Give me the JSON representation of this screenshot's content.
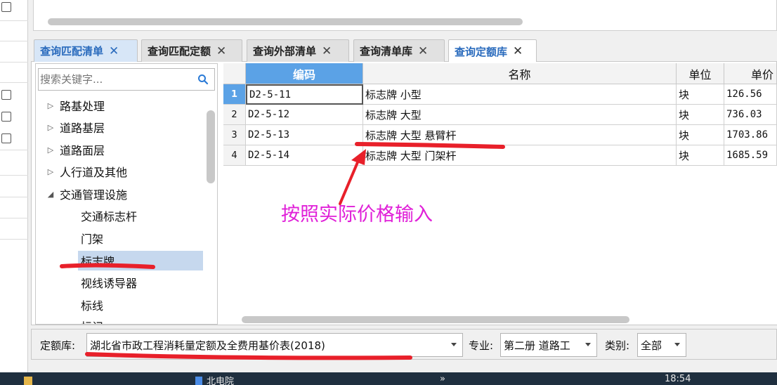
{
  "tabs": [
    {
      "label": "查询匹配清单",
      "state": "blue"
    },
    {
      "label": "查询匹配定额",
      "state": "normal"
    },
    {
      "label": "查询外部清单",
      "state": "normal"
    },
    {
      "label": "查询清单库",
      "state": "normal"
    },
    {
      "label": "查询定额库",
      "state": "active"
    }
  ],
  "tab_close_glyph": "✕",
  "search": {
    "placeholder": "搜索关键字..."
  },
  "tree": {
    "items": [
      {
        "label": "路基处理",
        "expanded": false
      },
      {
        "label": "道路基层",
        "expanded": false
      },
      {
        "label": "道路面层",
        "expanded": false
      },
      {
        "label": "人行道及其他",
        "expanded": false
      },
      {
        "label": "交通管理设施",
        "expanded": true
      }
    ],
    "children": [
      {
        "label": "交通标志杆",
        "selected": false
      },
      {
        "label": "门架",
        "selected": false
      },
      {
        "label": "标志牌",
        "selected": true
      },
      {
        "label": "视线诱导器",
        "selected": false
      },
      {
        "label": "标线",
        "selected": false
      },
      {
        "label": "标记",
        "selected": false
      }
    ]
  },
  "grid": {
    "headers": {
      "code": "编码",
      "name": "名称",
      "unit": "单位",
      "price": "单价"
    },
    "rows": [
      {
        "num": "1",
        "code": "D2-5-11",
        "name": "标志牌 小型",
        "unit": "块",
        "price": "126.56"
      },
      {
        "num": "2",
        "code": "D2-5-12",
        "name": "标志牌 大型",
        "unit": "块",
        "price": "736.03"
      },
      {
        "num": "3",
        "code": "D2-5-13",
        "name": "标志牌 大型 悬臂杆",
        "unit": "块",
        "price": "1703.86"
      },
      {
        "num": "4",
        "code": "D2-5-14",
        "name": "标志牌 大型 门架杆",
        "unit": "块",
        "price": "1685.59"
      }
    ]
  },
  "annotation": {
    "text": "按照实际价格输入",
    "color": "#e020d8"
  },
  "bottom": {
    "quota_label": "定额库:",
    "quota_value": "湖北省市政工程消耗量定额及全费用基价表(2018)",
    "major_label": "专业:",
    "major_value": "第二册 道路工",
    "category_label": "类别:",
    "category_value": "全部"
  },
  "taskbar": {
    "app_label": "北电院",
    "overflow": "»",
    "clock": "18:54"
  },
  "colors": {
    "accent": "#5ba2e6",
    "selection": "#c6d8ee",
    "markup_red": "#e8202a",
    "tab_blue_text": "#2a6bbd"
  }
}
